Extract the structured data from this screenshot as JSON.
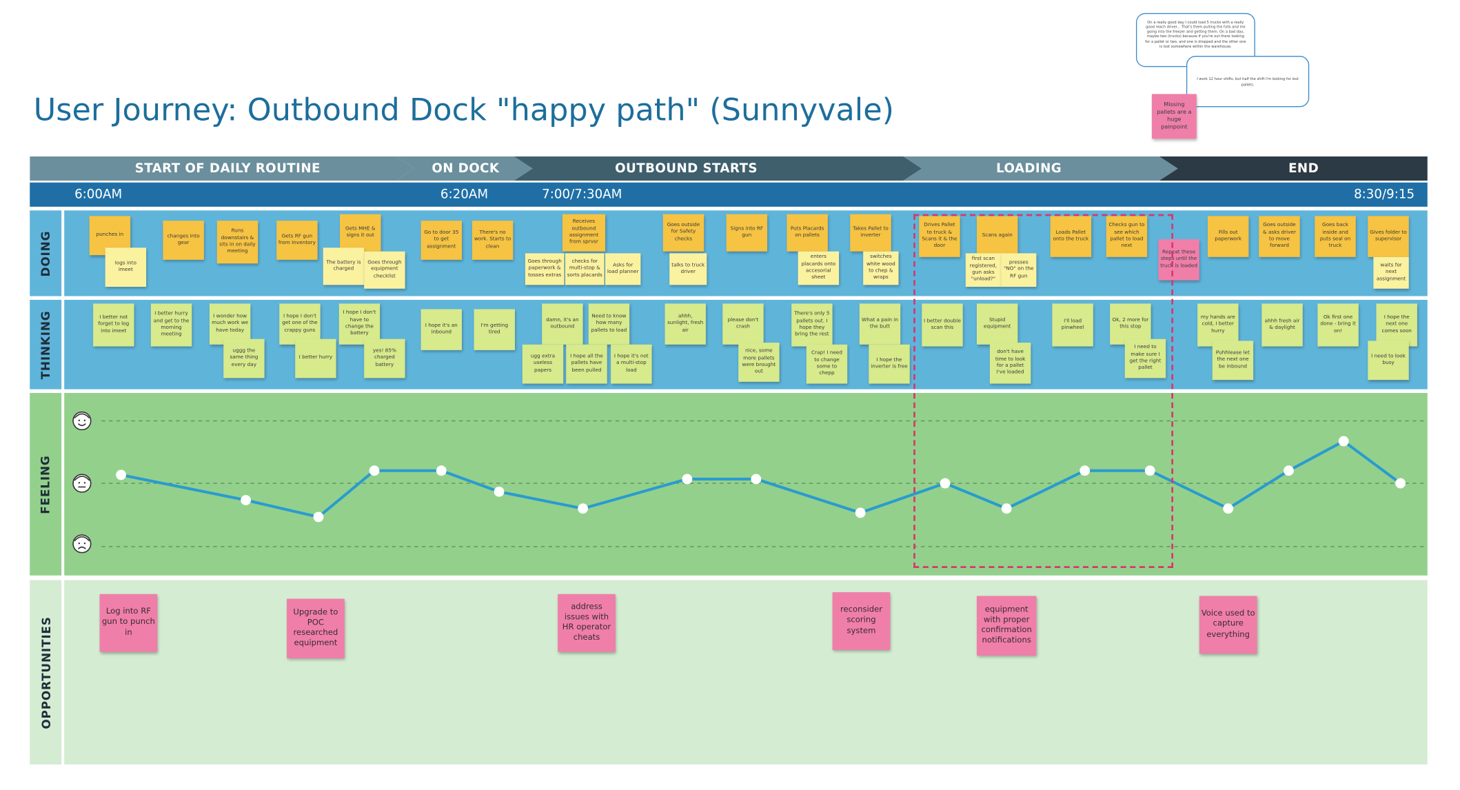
{
  "title": "User Journey: Outbound Dock \"happy path\" (Sunnyvale)",
  "phases": [
    "START OF DAILY ROUTINE",
    "ON DOCK",
    "OUTBOUND STARTS",
    "LOADING",
    "END"
  ],
  "times": [
    "6:00AM",
    "6:20AM",
    "7:00/7:30AM",
    "8:30/9:15"
  ],
  "lanes": [
    "DOING",
    "THINKING",
    "FEELING",
    "OPPORTUNITIES"
  ],
  "doing": [
    "punches in",
    "logs into imeet",
    "changes into gear",
    "Runs downstairs & sits in on daily meeting",
    "Gets RF gun from Inventory",
    "Gets MHE & signs it out",
    "The battery is charged",
    "Goes through equipment checklist",
    "Go to door 35 to get assignment",
    "There's no work. Starts to clean",
    "Receives outbound assignment from sprvsr",
    "Goes through paperwork & tosses extras",
    "checks for multi-stop & sorts placards",
    "Asks for load planner",
    "Goes outside for Safety checks",
    "talks to truck driver",
    "Signs into RF gun",
    "Puts Placards on pallets",
    "enters placards onto accesorial sheet",
    "Takes Pallet to inverter",
    "switches white wood to chep & wraps",
    "Drives Pallet to truck & Scans it & the door",
    "Scans again",
    "first scan registered, gun asks \"unload?\"",
    "presses \"NO\" on the RF gun",
    "Loads Pallet onto the truck",
    "Checks gun to see which pallet to load next",
    "Repeat these steps until the truck is loaded",
    "Fills out paperwork",
    "Goes outside & asks driver to move forward",
    "Goes back inside and puts seal on truck",
    "Gives folder to supervisor",
    "waits for next assignment"
  ],
  "thinking": [
    "I better not forget to log into imeet",
    "I better hurry and get to the morning meeting",
    "I wonder how much work we have today",
    "uggg the same thing every day",
    "I hope I don't get one of the crappy guns",
    "I better hurry",
    "I hope I don't have to change the battery",
    "yes! 85% charged battery",
    "I hope it's an inbound",
    "I'm getting tired",
    "damn, it's an outbound",
    "Need to know how many pallets to load",
    "ugg extra useless papers",
    "I hope all the pallets have been pulled",
    "I hope it's not a multi-stop load",
    "ahhh, sunlight, fresh air",
    "please don't crash",
    "nice, some more pallets were brought out",
    "There's only 5 pallets out. I hope they bring the rest",
    "Crap! I need to change some to chepp",
    "What a pain in the butt",
    "I hope the inverter is free",
    "I better double scan this",
    "Stupid equipment",
    "don't have time to look for a pallet I've loaded",
    "I'll load pinwheel",
    "Ok, 2 more for this stop",
    "I need to make sure I get the right pallet",
    "my hands are cold, I better hurry",
    "Puhhlease let the next one be inbound",
    "ahhh fresh air & daylight",
    "Ok first one done - bring it on!",
    "I hope the next one comes soon",
    "I need to look busy"
  ],
  "opportunities": [
    "Log into RF gun to punch in",
    "Upgrade to POC researched equipment",
    "address issues with HR operator cheats",
    "reconsider scoring system",
    "equipment with proper confirmation notifications",
    "Voice used to capture everything"
  ],
  "quotes": {
    "q1": "On a really good day I could load 5 trucks with a really good reach driver... That's them pulling the fulls and me going into the freezer and getting them. On a bad day, maybe two (trucks) because if you're out there looking for a pallet or two, and one is dropped and the other one is lost somewhere within the warehouse.",
    "q2": "I work 12 hour shifts, but half the shift I'm looking for lost pallets.",
    "painpoint": "Missing pallets are a huge painpoint"
  },
  "chart_data": {
    "type": "line",
    "title": "",
    "ylabel": "",
    "scale_levels": [
      "happy",
      "neutral",
      "sad"
    ],
    "x": [
      1,
      2,
      3,
      4,
      5,
      6,
      7,
      8,
      9,
      10,
      11,
      12,
      13,
      14,
      15,
      16,
      17,
      18,
      19,
      20
    ],
    "values": [
      0.1,
      -0.2,
      -0.4,
      0.15,
      0.15,
      -0.1,
      -0.3,
      0.05,
      0.05,
      -0.35,
      0.0,
      -0.3,
      0.15,
      0.15,
      -0.3,
      0.15,
      0.5,
      0.0
    ],
    "ylim": [
      -1,
      1
    ],
    "grid": true,
    "color": "#2a9bd0"
  },
  "colors": {
    "phase_dark": "#2b3a44",
    "phase_light": "#6b8f9c",
    "timebar": "#1f6fa6",
    "lane_blue": "#5fb4da",
    "lane_green": "#93d08c",
    "lane_light_green": "#d4ecd2",
    "accent_pink": "#d6386c"
  },
  "icons": [
    "happy-face-icon",
    "neutral-face-icon",
    "sad-face-icon"
  ]
}
